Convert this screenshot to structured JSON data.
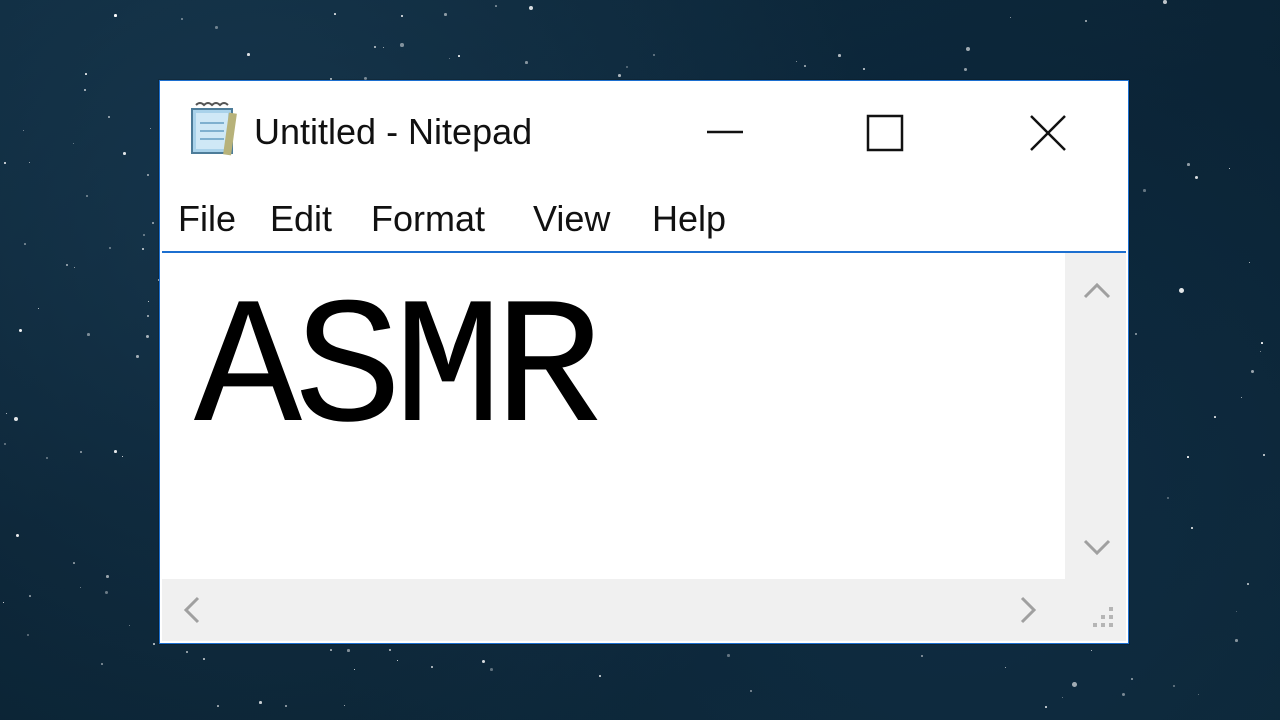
{
  "window": {
    "title": "Untitled - Nitepad",
    "controls": {
      "minimize_icon": "minimize-icon",
      "maximize_icon": "maximize-icon",
      "close_icon": "close-icon"
    }
  },
  "menu": {
    "items": [
      "File",
      "Edit",
      "Format",
      "View",
      "Help"
    ]
  },
  "editor": {
    "content": "ASMR"
  },
  "colors": {
    "window_border": "#1c6fd0",
    "scrollbar": "#f0f0f0",
    "desktop": "#0c2636"
  }
}
